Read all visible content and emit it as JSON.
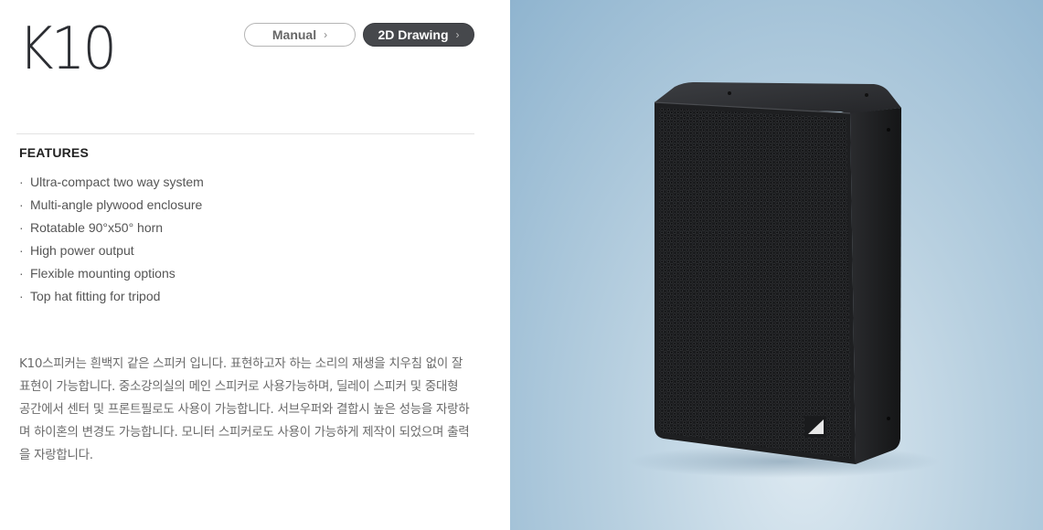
{
  "product": {
    "title": "K10"
  },
  "buttons": {
    "manual_label": "Manual",
    "drawing_label": "2D Drawing",
    "chevron": "›"
  },
  "features": {
    "heading": "FEATURES",
    "bullet": "·",
    "items": [
      "Ultra-compact two way system",
      "Multi-angle plywood enclosure",
      "Rotatable 90°x50° horn",
      "High power output",
      "Flexible mounting options",
      "Top hat fitting for tripod"
    ]
  },
  "description": "K10스피커는 흰백지 같은 스피커 입니다. 표현하고자 하는 소리의 재생을 치우침 없이 잘 표현이 가능합니다. 중소강의실의 메인 스피커로 사용가능하며, 딜레이 스피커 및 중대형 공간에서 센터 및 프론트필로도 사용이 가능합니다. 서브우퍼와 결합시 높은 성능을 자랑하며 하이혼의 변경도 가능합니다. 모니터 스피커로도 사용이 가능하게 제작이 되었으며 출력을 자랑합니다.",
  "image": {
    "subject": "black loudspeaker cabinet on light blue backdrop",
    "logo_icon": "triangle-logo-icon"
  },
  "colors": {
    "title": "#2c2e33",
    "drawing_button_bg": "#46484c",
    "manual_button_border": "#b5b5b5",
    "backdrop": "#a9c7dc",
    "speaker_body": "#1d1e20"
  }
}
